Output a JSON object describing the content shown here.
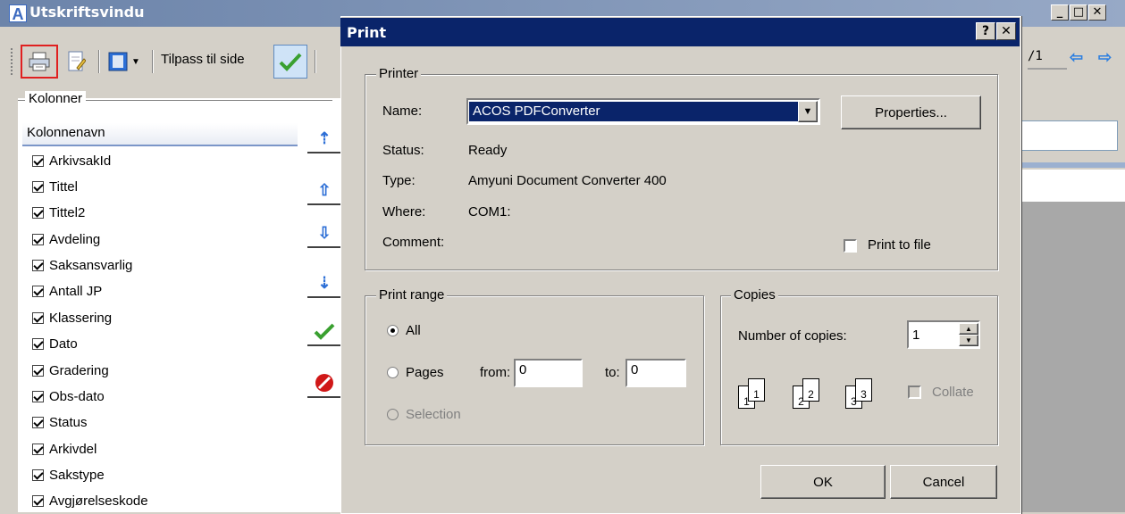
{
  "app": {
    "title": "Utskriftsvindu",
    "logo_letter": "A",
    "window_buttons": [
      "_",
      "□",
      "✕"
    ],
    "toolbar": {
      "fit_label": "Tilpass til side",
      "page_indicator": "/1"
    }
  },
  "left_panel": {
    "group_label": "Kolonner",
    "column_header": "Kolonnenavn",
    "items": [
      {
        "label": "ArkivsakId",
        "checked": true
      },
      {
        "label": "Tittel",
        "checked": true
      },
      {
        "label": "Tittel2",
        "checked": true
      },
      {
        "label": "Avdeling",
        "checked": true
      },
      {
        "label": "Saksansvarlig",
        "checked": true
      },
      {
        "label": "Antall JP",
        "checked": true
      },
      {
        "label": "Klassering",
        "checked": true
      },
      {
        "label": "Dato",
        "checked": true
      },
      {
        "label": "Gradering",
        "checked": true
      },
      {
        "label": "Obs-dato",
        "checked": true
      },
      {
        "label": "Status",
        "checked": true
      },
      {
        "label": "Arkivdel",
        "checked": true
      },
      {
        "label": "Sakstype",
        "checked": true
      },
      {
        "label": "Avgjørelseskode",
        "checked": true
      }
    ],
    "side_buttons": [
      "move-top",
      "move-up",
      "move-down",
      "move-bottom",
      "apply",
      "cancel"
    ]
  },
  "dialog": {
    "title": "Print",
    "help_button": "?",
    "close_button": "✕",
    "printer": {
      "group_label": "Printer",
      "name_label": "Name:",
      "name_value": "ACOS PDFConverter",
      "properties_button": "Properties...",
      "status_label": "Status:",
      "status_value": "Ready",
      "type_label": "Type:",
      "type_value": "Amyuni Document Converter 400",
      "where_label": "Where:",
      "where_value": "COM1:",
      "comment_label": "Comment:",
      "print_to_file_label": "Print to file",
      "print_to_file": false
    },
    "print_range": {
      "group_label": "Print range",
      "all_label": "All",
      "pages_label": "Pages",
      "from_label": "from:",
      "from_value": "0",
      "to_label": "to:",
      "to_value": "0",
      "selection_label": "Selection",
      "selected": "All"
    },
    "copies": {
      "group_label": "Copies",
      "number_label": "Number of copies:",
      "number_value": "1",
      "collate_label": "Collate",
      "collate": false,
      "page_icon_numbers": [
        "1",
        "1",
        "2",
        "2",
        "3",
        "3"
      ]
    },
    "ok_button": "OK",
    "cancel_button": "Cancel"
  },
  "colors": {
    "dialog_title_bg": "#0a246a",
    "app_title_bg": "#6c84aa",
    "highlight_border": "#e02020",
    "selection_bg": "#0a246a"
  }
}
